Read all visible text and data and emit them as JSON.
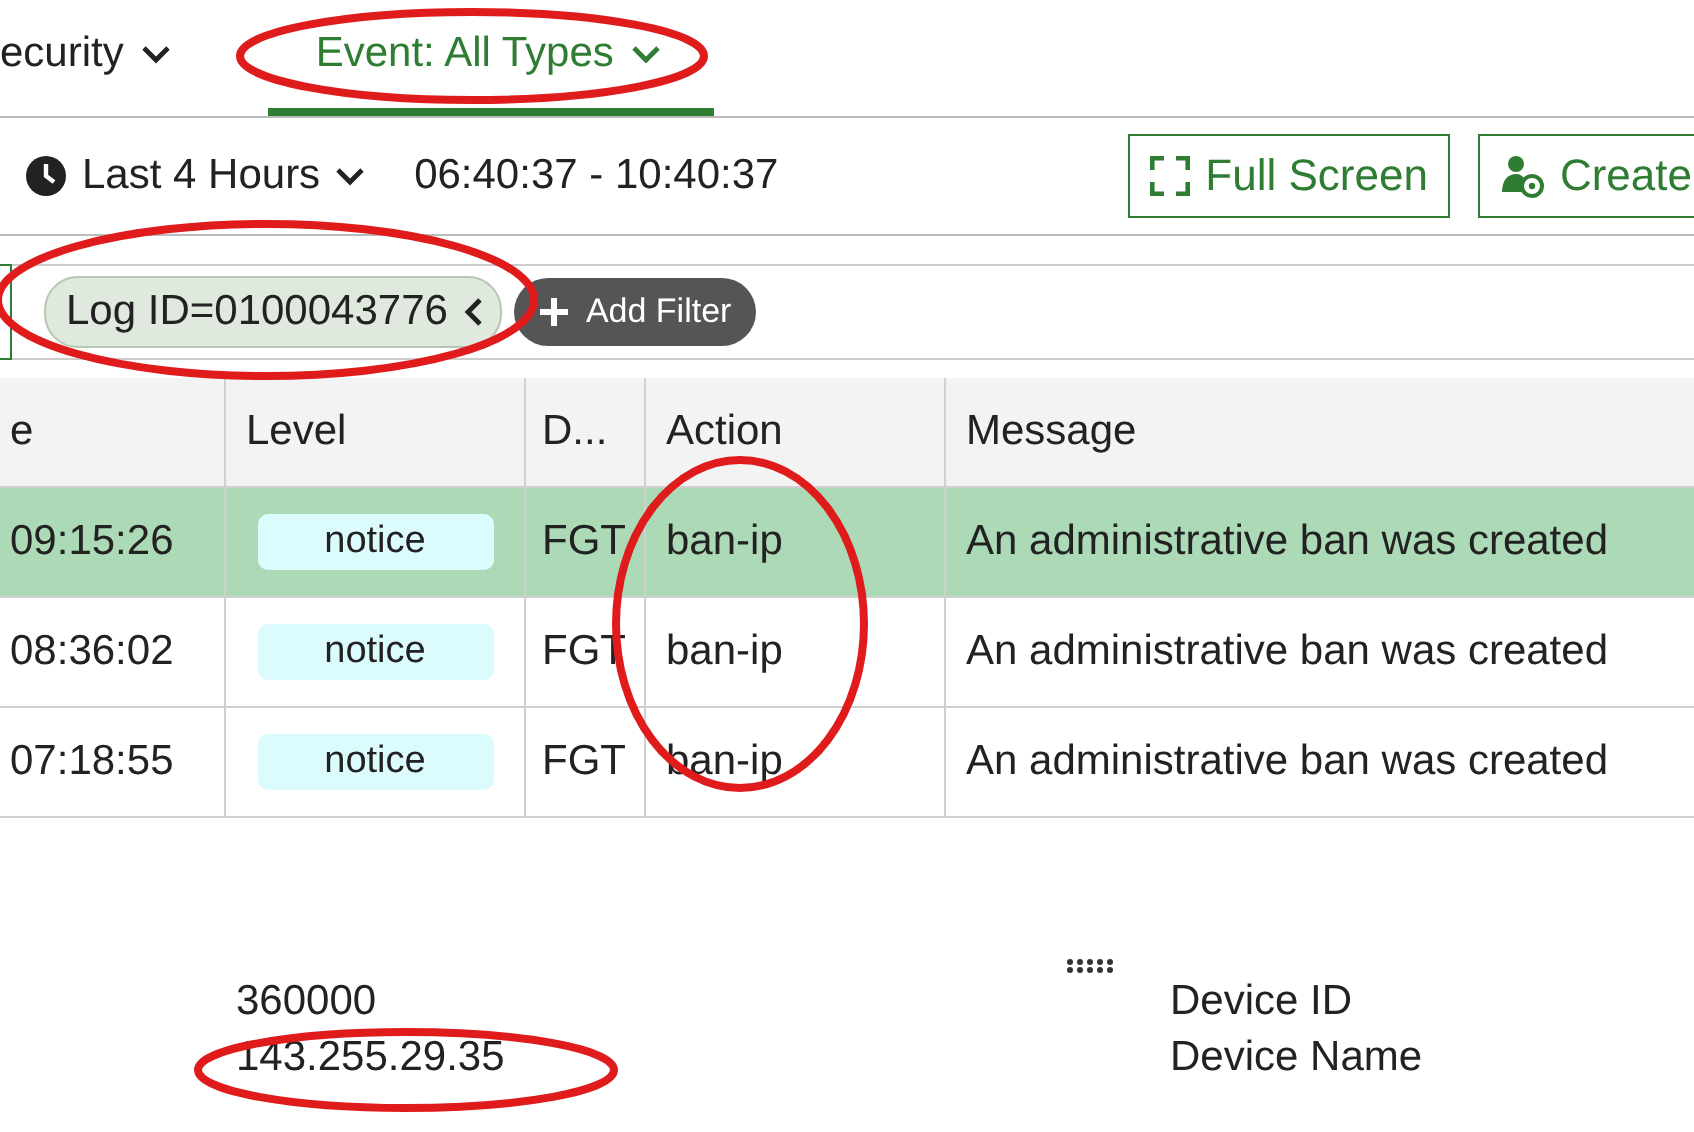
{
  "tabs": [
    {
      "label": "ecurity",
      "selected": false
    },
    {
      "label": "Event: All Types",
      "selected": true
    }
  ],
  "toolbar": {
    "time_range": "Last 4 Hours",
    "time_span": "06:40:37 - 10:40:37",
    "buttons": [
      {
        "label": "Full Screen",
        "kind": "fullscreen"
      },
      {
        "label": "Create",
        "kind": "create"
      }
    ]
  },
  "filters": {
    "chips": [
      "Log ID=0100043776"
    ],
    "add_button": "Add Filter"
  },
  "table": {
    "columns": [
      "e",
      "Level",
      "D...",
      "Action",
      "Message"
    ],
    "rows": [
      {
        "selected": true,
        "cells": [
          "09:15:26",
          "notice",
          "FGT",
          "ban-ip",
          "An administrative ban was created"
        ]
      },
      {
        "selected": false,
        "cells": [
          "08:36:02",
          "notice",
          "FGT",
          "ban-ip",
          "An administrative ban was created"
        ]
      },
      {
        "selected": false,
        "cells": [
          "07:18:55",
          "notice",
          "FGT",
          "ban-ip",
          "An administrative ban was created"
        ]
      }
    ]
  },
  "details": {
    "values": [
      "360000",
      "143.255.29.35"
    ],
    "labels": [
      "Device ID",
      "Device Name"
    ]
  }
}
